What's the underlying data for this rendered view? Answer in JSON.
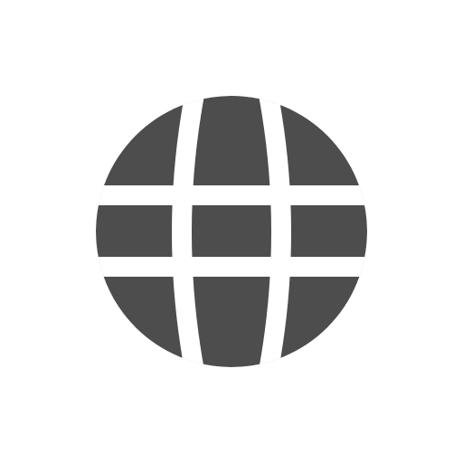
{
  "icon": {
    "name": "globe-icon",
    "color": "#4d4d4d",
    "gap_color": "#ffffff",
    "background": "#ffffff"
  }
}
